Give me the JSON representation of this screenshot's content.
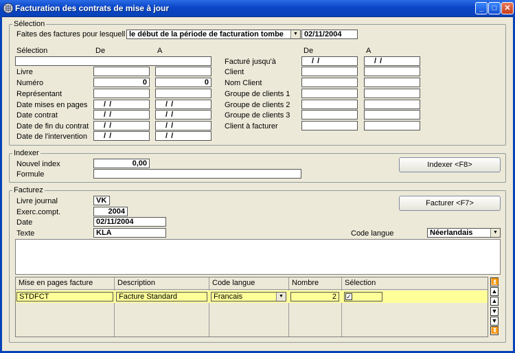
{
  "window": {
    "title": "Facturation des contrats de mise à jour",
    "minimize": "_",
    "maximize": "□",
    "close": "✕"
  },
  "selection": {
    "legend": "Sélection",
    "intro_label": "Faites des factures pour lesquell",
    "period_select": "le début de la période de facturation tombe",
    "period_date": "02/11/2004",
    "col_selection": "Sélection",
    "col_de": "De",
    "col_a": "A",
    "left_rows": [
      {
        "label": "Livre",
        "de": "",
        "a": ""
      },
      {
        "label": "Numéro",
        "de": "0",
        "a": "0"
      },
      {
        "label": "Représentant",
        "de": "",
        "a": ""
      },
      {
        "label": "Date mises en pages",
        "de": "/ /",
        "a": "/ /"
      },
      {
        "label": "Date contrat",
        "de": "/ /",
        "a": "/ /"
      },
      {
        "label": "Date de fin du contrat",
        "de": "/ /",
        "a": "/ /"
      },
      {
        "label": "Date de l'intervention",
        "de": "/ /",
        "a": "/ /"
      }
    ],
    "right_col_de": "De",
    "right_col_a": "A",
    "right_rows": [
      {
        "label": "Facturé jusqu'à",
        "de": "/ /",
        "a": "/ /"
      },
      {
        "label": "Client",
        "de": "",
        "a": ""
      },
      {
        "label": "Nom Client",
        "de": "",
        "a": ""
      },
      {
        "label": "Groupe de clients 1",
        "de": "",
        "a": ""
      },
      {
        "label": "Groupe de clients 2",
        "de": "",
        "a": ""
      },
      {
        "label": "Groupe de clients 3",
        "de": "",
        "a": ""
      },
      {
        "label": "Client à facturer",
        "de": "",
        "a": ""
      }
    ]
  },
  "indexer": {
    "legend": "Indexer",
    "nouvel_index_label": "Nouvel index",
    "nouvel_index_value": "0,00",
    "formule_label": "Formule",
    "formule_value": "",
    "button": "Indexer <F8>"
  },
  "facturez": {
    "legend": "Facturez",
    "livre_label": "Livre journal",
    "livre_value": "VK",
    "exerc_label": "Exerc.compt.",
    "exerc_value": "2004",
    "date_label": "Date",
    "date_value": "02/11/2004",
    "texte_label": "Texte",
    "texte_value": "KLA",
    "code_langue_label": "Code langue",
    "code_langue_value": "Néerlandais",
    "button": "Facturer <F7>"
  },
  "grid": {
    "headers": [
      "Mise en pages facture",
      "Description",
      "Code langue",
      "Nombre",
      "Sélection"
    ],
    "rows": [
      {
        "mise": "STDFCT",
        "description": "Facture Standard",
        "code": "Francais",
        "nombre": "2",
        "selection": "✓"
      }
    ],
    "nav": [
      "⏫",
      "▲",
      "▲",
      "▼",
      "▼",
      "⏬"
    ]
  }
}
